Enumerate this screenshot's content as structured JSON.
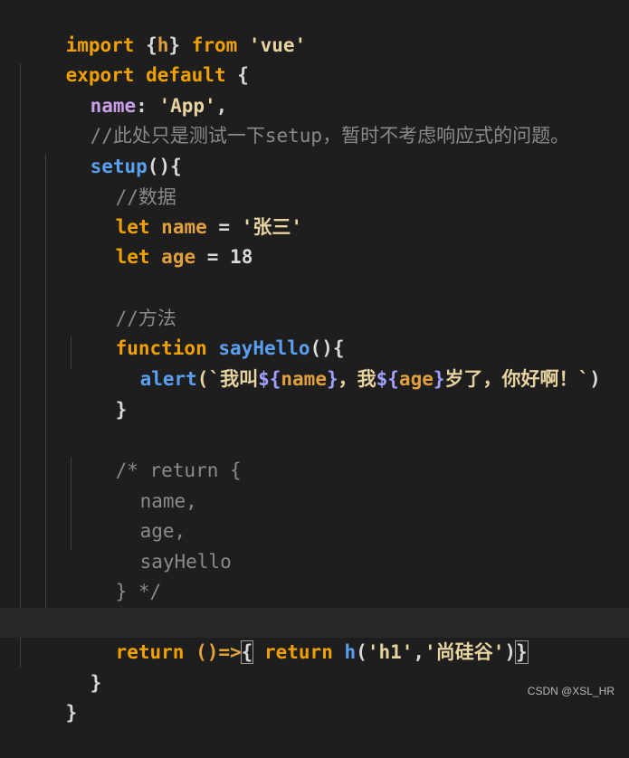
{
  "code": {
    "l1": {
      "t1": "import",
      "t2": " {",
      "t3": "h",
      "t4": "} ",
      "t5": "from",
      "t6": " ",
      "t7": "'vue'"
    },
    "l2": {
      "t1": "export default",
      "t2": " {"
    },
    "l3": {
      "t1": "name",
      "t2": ": ",
      "t3": "'App'",
      "t4": ","
    },
    "l4": {
      "t1": "//此处只是测试一下setup，暂时不考虑响应式的问题。"
    },
    "l5": {
      "t1": "setup",
      "t2": "(){"
    },
    "l6": {
      "t1": "//数据"
    },
    "l7": {
      "t1": "let",
      "t2": " ",
      "t3": "name",
      "t4": " = ",
      "t5": "'张三'"
    },
    "l8": {
      "t1": "let",
      "t2": " ",
      "t3": "age",
      "t4": " = ",
      "t5": "18"
    },
    "l10": {
      "t1": "//方法"
    },
    "l11": {
      "t1": "function",
      "t2": " ",
      "t3": "sayHello",
      "t4": "(){"
    },
    "l12": {
      "t1": "alert",
      "t2": "(`",
      "t3": "我叫",
      "t4": "${",
      "t5": "name",
      "t6": "}",
      "t7": "，我",
      "t8": "${",
      "t9": "age",
      "t10": "}",
      "t11": "岁了，你好啊！`",
      "t12": ")"
    },
    "l13": {
      "t1": "}"
    },
    "l15": {
      "t1": "/* return {"
    },
    "l16": {
      "t1": "name,"
    },
    "l17": {
      "t1": "age,"
    },
    "l18": {
      "t1": "sayHello"
    },
    "l19": {
      "t1": "} */"
    },
    "l21": {
      "t1": "return",
      "t2": " ",
      "t3": "()=>",
      "t4": "{",
      "t5": " ",
      "t6": "return",
      "t7": " ",
      "t8": "h",
      "t9": "(",
      "t10": "'h1'",
      "t11": ",",
      "t12": "'尚硅谷'",
      "t13": ")",
      "t14": "}"
    },
    "l22": {
      "t1": "}"
    },
    "l23": {
      "t1": "}"
    }
  },
  "watermark": "CSDN @XSL_HR",
  "colors": {
    "background": "#1e1e1e",
    "keyword": "#f0a000",
    "string": "#e6d3a0",
    "function": "#5aa0f0",
    "property": "#c8a0e8",
    "comment": "#8a8a8a"
  }
}
